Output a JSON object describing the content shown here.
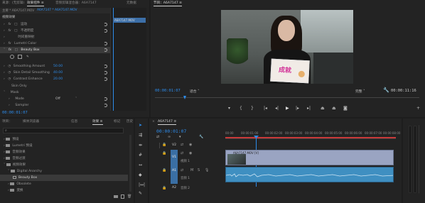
{
  "top_tabs": {
    "tab1": "来源：(无剪辑)",
    "tab2": "效果控件 ≡",
    "tab3": "音频剪辑混合器：A6A7147",
    "tab4": "元数据",
    "program_tab": "节目：A6A7147 ≡"
  },
  "effect_controls": {
    "master": "主要 * A6A7147.MOV",
    "sequence": "A6A7147 * A6A7147.MOV",
    "video_effects": "视频效果",
    "motion": "运动",
    "opacity": "不透明度",
    "time_remap": "时间重映射",
    "lumetri": "Lumetri Color",
    "beauty": "Beauty Box",
    "smoothing_amount_label": "Smoothing Amount",
    "smoothing_amount_value": "50.00",
    "skin_detail_label": "Skin Detail Smoothing",
    "skin_detail_value": "40.00",
    "contrast_label": "Contrast Enhance",
    "contrast_value": "20.00",
    "skin_only": "Skin Only",
    "mask": "Mask",
    "mode_label": "Mode",
    "mode_value": "Off",
    "sampler": "Sampler",
    "clip_name": "A6A7147.MOV",
    "timecode": "00:00:01:07"
  },
  "program": {
    "timecode_left": "00:00:01:07",
    "fit_label": "适合",
    "quality_label": "完整",
    "timecode_right": "00:00:11:16",
    "card_text": "成就"
  },
  "project": {
    "tabs": [
      "项目：",
      "媒体浏览器",
      "信息",
      "效果 ≡",
      "标记",
      "历史"
    ],
    "items": [
      {
        "label": "预设",
        "indent": 0
      },
      {
        "label": "Lumetri 预设",
        "indent": 0
      },
      {
        "label": "音频效果",
        "indent": 0
      },
      {
        "label": "音频过渡",
        "indent": 0
      },
      {
        "label": "视频效果",
        "indent": 0
      },
      {
        "label": "Digital Anarchy",
        "indent": 1
      },
      {
        "label": "Beauty Box",
        "indent": 2
      },
      {
        "label": "Obsolete",
        "indent": 1
      },
      {
        "label": "变换",
        "indent": 1
      }
    ]
  },
  "timeline": {
    "tab": "A6A7147 ≡",
    "timecode": "00:00:01:07",
    "ruler": [
      "00:00",
      "00:00:01:00",
      "00:00:02:00",
      "00:00:03:00",
      "00:00:04:00",
      "00:00:05:00",
      "00:00:06:00",
      "00:00:07:00",
      "00:00:08:00"
    ],
    "tracks": [
      "V2",
      "V1",
      "A1",
      "A2"
    ],
    "video_clip": "A6A7147.MOV [V]",
    "v1_label": "视频 1",
    "a1_label": "音频 1",
    "a2_label": "音频 2"
  },
  "colors": {
    "accent": "#2d8ceb",
    "video_clip": "#9aa4c2",
    "audio_clip": "#3f8fc1"
  }
}
